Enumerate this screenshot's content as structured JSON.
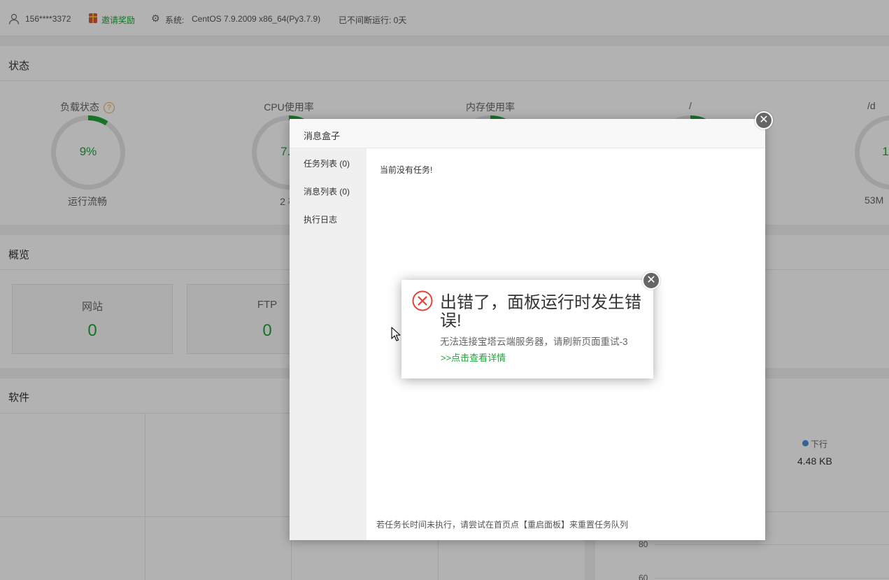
{
  "header": {
    "user": "156****3372",
    "invite": "邀请奖励",
    "system_label": "系统:",
    "system_value": "CentOS 7.9.2009 x86_64(Py3.7.9)",
    "uptime": "已不间断运行: 0天"
  },
  "status": {
    "title": "状态",
    "gauges": [
      {
        "title": "负载状态",
        "value": "9%",
        "sub": "运行流畅",
        "fraction": 0.09
      },
      {
        "title": "CPU使用率",
        "value": "7.5",
        "sub": "2 核",
        "fraction": 0.075
      },
      {
        "title": "内存使用率",
        "value": "",
        "sub": "",
        "fraction": 0.1
      },
      {
        "title": "/",
        "value": "",
        "sub": "",
        "fraction": 0.1
      },
      {
        "title": "/d",
        "value": "1",
        "sub": "53M",
        "fraction": 0.1
      }
    ]
  },
  "overview": {
    "title": "概览",
    "cards": [
      {
        "title": "网站",
        "value": "0"
      },
      {
        "title": "FTP",
        "value": "0"
      }
    ]
  },
  "software": {
    "title": "软件"
  },
  "traffic": {
    "legend_down": "下行",
    "down_value": "4.48 KB",
    "ticks": [
      "80",
      "60"
    ]
  },
  "msgbox": {
    "title": "消息盒子",
    "tabs": [
      "任务列表 (0)",
      "消息列表 (0)",
      "执行日志"
    ],
    "empty_text": "当前没有任务!",
    "footer": "若任务长时间未执行，请尝试在首页点【重启面板】来重置任务队列"
  },
  "error": {
    "title": "出错了，面板运行时发生错误!",
    "message": "无法连接宝塔云端服务器，请刷新页面重试-3",
    "link": ">>点击查看详情"
  },
  "colors": {
    "accent": "#20a53a",
    "error": "#e0443a",
    "warning": "#f0ad4e"
  }
}
